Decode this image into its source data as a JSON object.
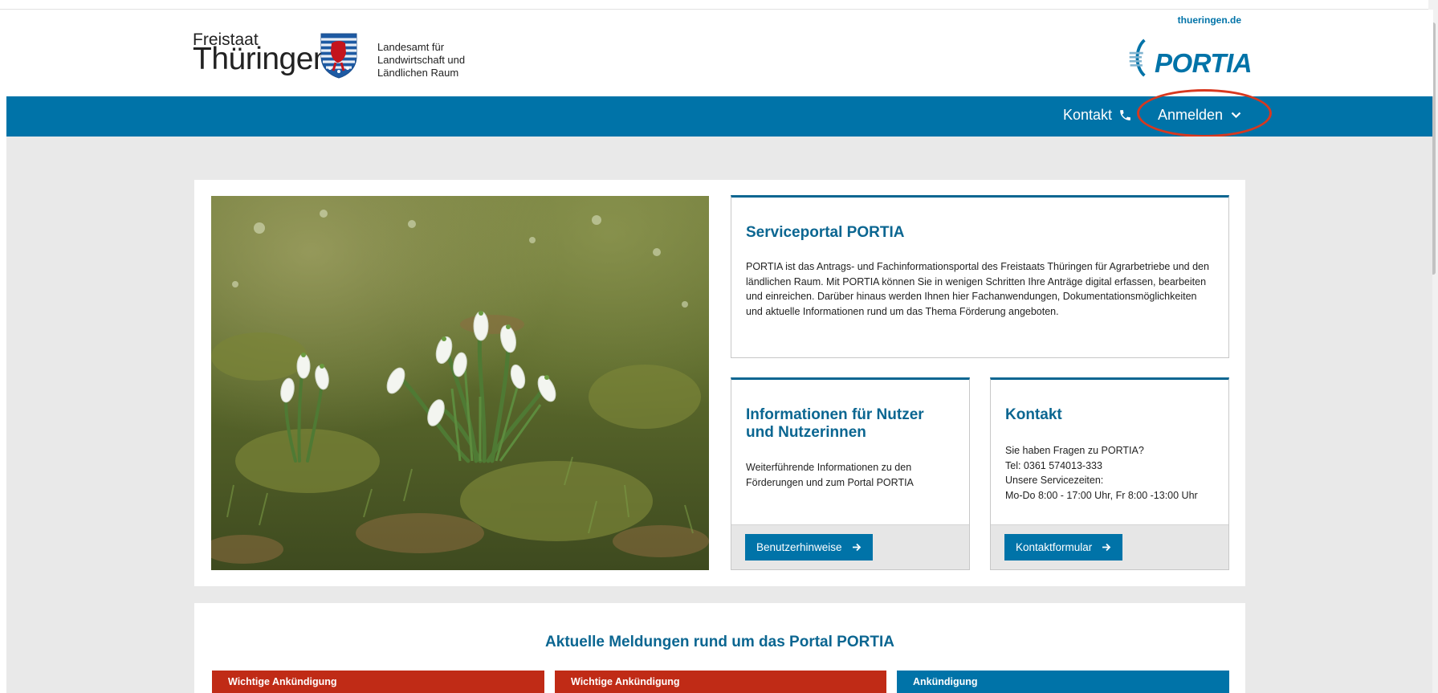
{
  "header": {
    "gov_link": "thueringen.de",
    "logo_freistaat": "Freistaat",
    "logo_thueringen": "Thüringen",
    "agency_lines": [
      "Landesamt für",
      "Landwirtschaft und",
      "Ländlichen Raum"
    ],
    "portal_logo": "PORTIA"
  },
  "nav": {
    "kontakt_label": "Kontakt",
    "kontakt_icon": "phone-icon",
    "anmelden_label": "Anmelden",
    "anmelden_icon": "chevron-down-icon",
    "highlight_color": "#d8381f"
  },
  "hero": {
    "image_alt": "Schneeglöckchen auf einer Wiese"
  },
  "service_card": {
    "title": "Serviceportal PORTIA",
    "body": "PORTIA ist das Antrags- und Fachinformationsportal des Freistaats Thüringen für Agrarbetriebe und den ländlichen Raum. Mit PORTIA können Sie in wenigen Schritten Ihre Anträge digital erfassen, bearbeiten und einreichen. Darüber hinaus werden Ihnen hier Fachanwendungen, Dokumentationsmöglichkeiten und aktuelle Informationen rund um das Thema Förderung angeboten."
  },
  "info_card": {
    "title": "Informationen für Nutzer und Nutzerinnen",
    "body": "Weiterführende Informationen zu den Förderungen und zum Portal PORTIA",
    "button_label": "Benutzerhinweise"
  },
  "contact_card": {
    "title": "Kontakt",
    "lines": [
      "Sie haben Fragen zu PORTIA?",
      "Tel: 0361 574013-333",
      "Unsere Servicezeiten:",
      "Mo-Do 8:00 - 17:00 Uhr, Fr 8:00 -13:00 Uhr"
    ],
    "button_label": "Kontaktformular"
  },
  "news": {
    "heading": "Aktuelle Meldungen rund um das Portal PORTIA",
    "tabs": [
      {
        "label": "Wichtige Ankündigung",
        "color": "#c02b16"
      },
      {
        "label": "Wichtige Ankündigung",
        "color": "#c02b16"
      },
      {
        "label": "Ankündigung",
        "color": "#0073a8"
      }
    ]
  },
  "colors": {
    "brand_blue": "#0073a8",
    "heading_blue": "#0b6691",
    "alert_red": "#c02b16",
    "page_gray": "#e9e9e9"
  }
}
